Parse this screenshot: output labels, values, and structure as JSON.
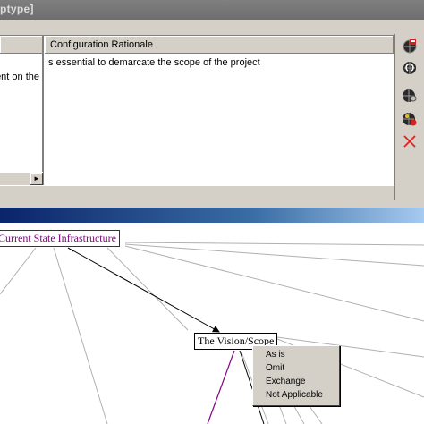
{
  "window": {
    "title_fragment": "ptype]"
  },
  "grid": {
    "columns": [
      {
        "label": ""
      },
      {
        "label": "Configuration Rationale"
      }
    ],
    "rows": [
      {
        "left_text": "ent on the",
        "rationale": "Is essential to demarcate the scope of the project"
      }
    ],
    "scroll_right_glyph": "►"
  },
  "toolbar": {
    "icons": [
      "save-globe-icon",
      "globe-refresh-icon",
      "globe-gear-icon",
      "globe-add-icon",
      "delete-icon"
    ],
    "delete_color": "#e32020"
  },
  "diagram": {
    "nodes": [
      {
        "label": "Current State Infrastructure",
        "border": "#800080",
        "color": "#800080"
      },
      {
        "label": "The Vision/Scope",
        "border": "#000000",
        "color": "#000000"
      }
    ]
  },
  "context_menu": {
    "items": [
      "As is",
      "Omit",
      "Exchange",
      "Not Applicable"
    ]
  }
}
